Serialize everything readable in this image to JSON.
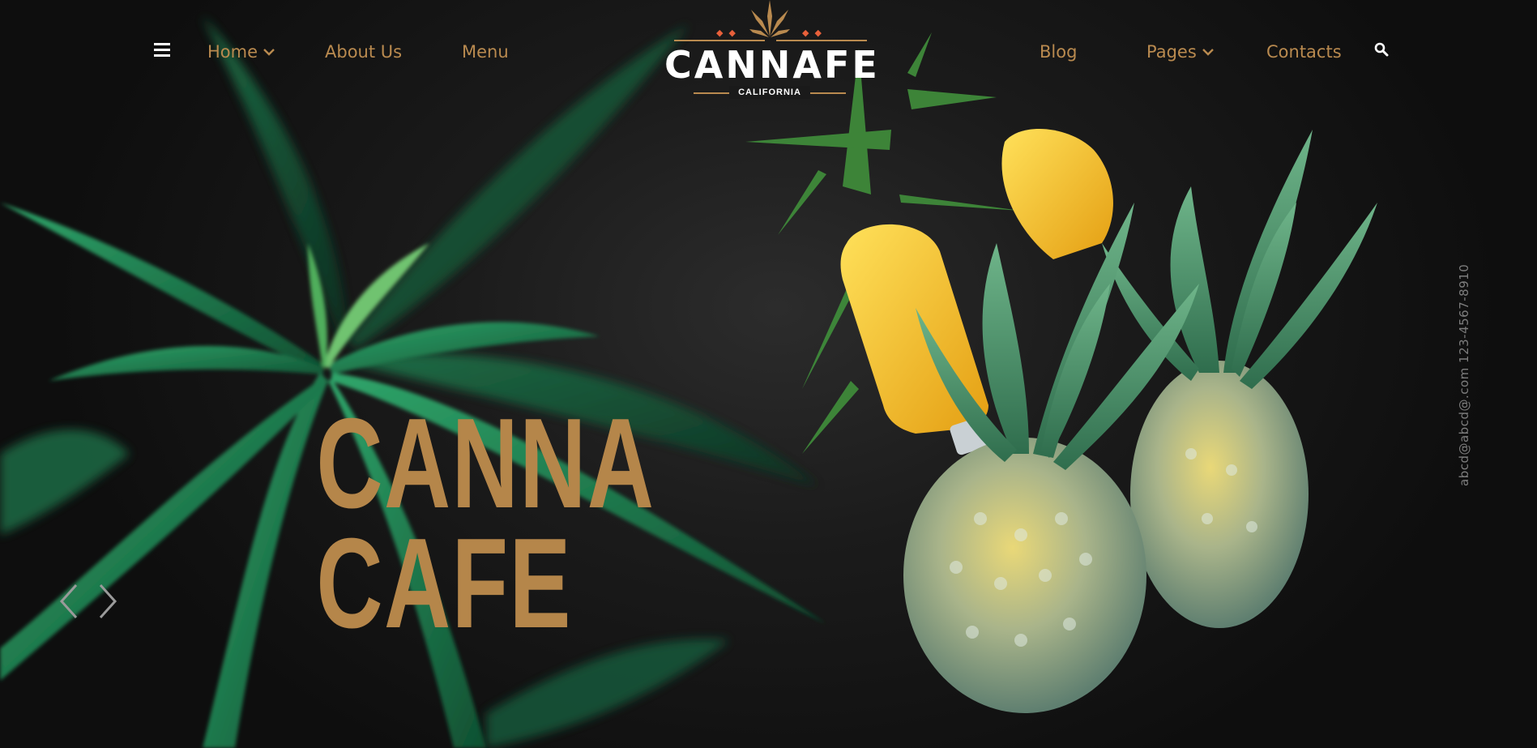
{
  "nav": {
    "left": [
      {
        "label": "Home",
        "has_dropdown": true
      },
      {
        "label": "About Us",
        "has_dropdown": false
      },
      {
        "label": "Menu",
        "has_dropdown": false
      }
    ],
    "right": [
      {
        "label": "Blog",
        "has_dropdown": false
      },
      {
        "label": "Pages",
        "has_dropdown": true
      },
      {
        "label": "Contacts",
        "has_dropdown": false
      }
    ],
    "menu_icon": "hamburger-icon",
    "search_icon": "search-icon"
  },
  "logo": {
    "name": "CANNAFE",
    "subtitle": "CALIFORNIA",
    "icon": "cannabis-leaf-icon"
  },
  "hero": {
    "line1": "CANNA",
    "line2": "CAFE"
  },
  "slider": {
    "prev_icon": "chevron-left-icon",
    "next_icon": "chevron-right-icon"
  },
  "contact": {
    "text": "abcd@abcd@.com  123-4567-8910"
  },
  "colors": {
    "accent": "#b98a4f",
    "background": "#141414",
    "logo_dots": "#e8603a",
    "text_light": "#ffffff"
  }
}
